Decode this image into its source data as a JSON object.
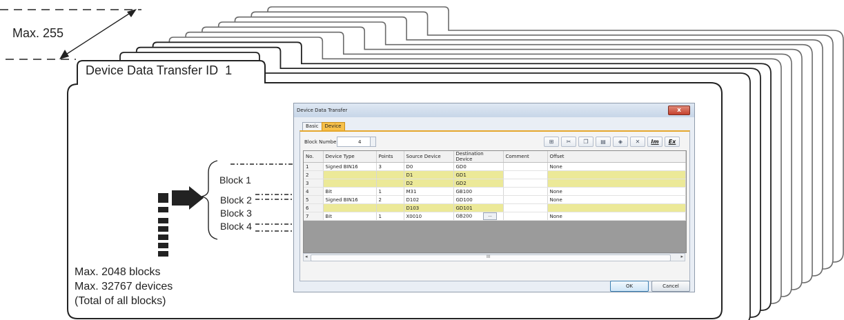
{
  "labels": {
    "max_ids": "Max. 255",
    "tab_title_prefix": "Device Data Transfer ID",
    "tab_title_number": "1",
    "block1": "Block 1",
    "block2": "Block 2",
    "block3": "Block 3",
    "block4": "Block 4",
    "max_blocks": "Max. 2048 blocks",
    "max_devices": "Max. 32767 devices",
    "total_note": "(Total of all blocks)"
  },
  "dialog": {
    "title": "Device Data Transfer",
    "close": "x",
    "tabs": [
      "Basic",
      "Device"
    ],
    "active_tab": "Device",
    "block_number_label": "Block Number:",
    "block_number_value": "4",
    "toolbar_icons": [
      "insert-row-icon",
      "cut-icon",
      "copy-icon",
      "paste-icon",
      "erase-icon",
      "delete-icon",
      "batch-edit-icon",
      "export-icon"
    ],
    "toolbar_text_buttons": {
      "batch_edit": "Im",
      "export": "Ex"
    },
    "columns": [
      "No.",
      "Device Type",
      "Points",
      "Source Device",
      "Destination Device",
      "Comment",
      "Offset"
    ],
    "rows": [
      {
        "no": "1",
        "device_type": "Signed BIN16",
        "points": "3",
        "source": "D0",
        "destination": "GD0",
        "comment": "",
        "offset": "None",
        "highlight": false
      },
      {
        "no": "2",
        "device_type": "",
        "points": "",
        "source": "D1",
        "destination": "GD1",
        "comment": "",
        "offset": "",
        "highlight": true
      },
      {
        "no": "3",
        "device_type": "",
        "points": "",
        "source": "D2",
        "destination": "GD2",
        "comment": "",
        "offset": "",
        "highlight": true
      },
      {
        "no": "4",
        "device_type": "Bit",
        "points": "1",
        "source": "M31",
        "destination": "GB100",
        "comment": "",
        "offset": "None",
        "highlight": false
      },
      {
        "no": "5",
        "device_type": "Signed BIN16",
        "points": "2",
        "source": "D102",
        "destination": "GD100",
        "comment": "",
        "offset": "None",
        "highlight": false
      },
      {
        "no": "6",
        "device_type": "",
        "points": "",
        "source": "D103",
        "destination": "GD101",
        "comment": "",
        "offset": "",
        "highlight": true
      },
      {
        "no": "7",
        "device_type": "Bit",
        "points": "1",
        "source": "X0010",
        "destination": "GB200",
        "comment": "",
        "offset": "None",
        "highlight": false
      }
    ],
    "ellipsis": "...",
    "scroll_mark": "III",
    "ok": "OK",
    "cancel": "Cancel"
  },
  "colors": {
    "row_highlight": "#ece998",
    "active_tab": "#f7c04a",
    "frame_line": "#222222"
  }
}
